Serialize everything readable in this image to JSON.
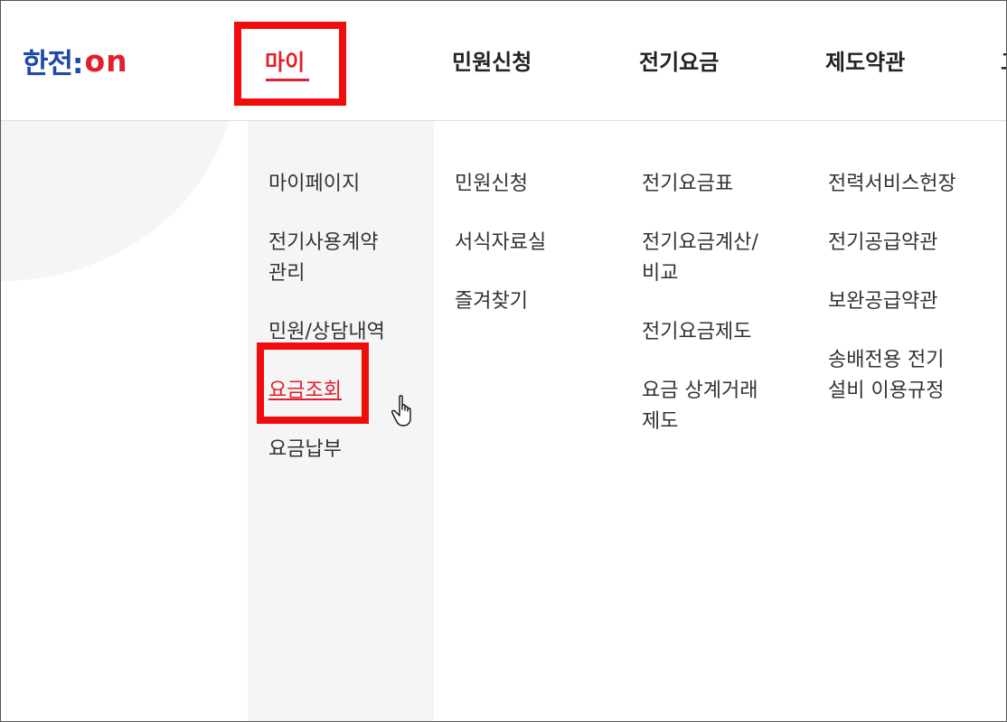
{
  "header": {
    "logo_korean": "한전:",
    "logo_on": "on",
    "nav": [
      "마이",
      "민원신청",
      "전기요금",
      "제도약관",
      "고"
    ]
  },
  "menu": {
    "col1": [
      "마이페이지",
      "전기사용계약 관리",
      "민원/상담내역",
      "요금조회",
      "요금납부"
    ],
    "col2": [
      "민원신청",
      "서식자료실",
      "즐겨찾기"
    ],
    "col3": [
      "전기요금표",
      "전기요금계산/ 비교",
      "전기요금제도",
      "요금 상계거래 제도"
    ],
    "col4": [
      "전력서비스헌장",
      "전기공급약관",
      "보완공급약관",
      "송배전용 전기 설비 이용규정"
    ]
  },
  "colors": {
    "accent": "#e2202c",
    "brand_blue": "#1d4aa8",
    "highlight_box": "#f20d0d"
  },
  "icons": {
    "cursor": "hand-pointer-icon"
  }
}
